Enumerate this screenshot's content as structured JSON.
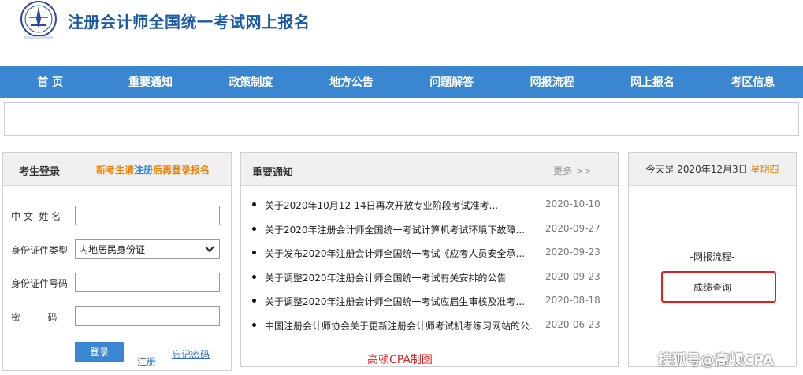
{
  "header": {
    "title": "注册会计师全国统一考试网上报名",
    "logo_icon": "cicpa-seal-icon"
  },
  "nav": {
    "items": [
      "首 页",
      "重要通知",
      "政策制度",
      "地方公告",
      "问题解答",
      "网报流程",
      "网上报名",
      "考区信息"
    ]
  },
  "login": {
    "title": "考生登录",
    "note_prefix": "新考生请",
    "note_link": "注册",
    "note_suffix": "后再登录报名",
    "name_label": "中 文  姓 名",
    "id_type_label": "身份证件类型",
    "id_type_value": "内地居民身份证",
    "id_number_label": "身份证件号码",
    "password_label": "密         码",
    "submit_label": "登录",
    "register_label": "注册",
    "forgot_label": "忘记密码"
  },
  "notices": {
    "title": "重要通知",
    "more_label": "更多 >>",
    "items": [
      {
        "text": "关于2020年10月12-14日再次开放专业阶段考试准考...",
        "date": "2020-10-10"
      },
      {
        "text": "关于2020年注册会计师全国统一考试计算机考试环境下故障...",
        "date": "2020-09-27"
      },
      {
        "text": "关于发布2020年注册会计师全国统一考试《应考人员安全承...",
        "date": "2020-09-23"
      },
      {
        "text": "关于调整2020年注册会计师全国统一考试有关安排的公告",
        "date": "2020-09-23"
      },
      {
        "text": "关于调整2020年注册会计师全国统一考试应届生审核及准考...",
        "date": "2020-08-18"
      },
      {
        "text": "中国注册会计师协会关于更新注册会计师考试机考练习网站的公...",
        "date": "2020-06-23"
      }
    ],
    "watermark": "高顿CPA制图"
  },
  "sidebar": {
    "today_prefix": "今天是 2020年12月3日",
    "weekday": "星期四",
    "link_process": "-网报流程-",
    "link_score": "-成绩查询-"
  },
  "watermark": "搜狐号@高顿CPA",
  "colors": {
    "nav_bg": "#3a86d0",
    "title_blue": "#1a5aa6",
    "accent_orange": "#f08300",
    "highlight_red": "#e02020"
  }
}
